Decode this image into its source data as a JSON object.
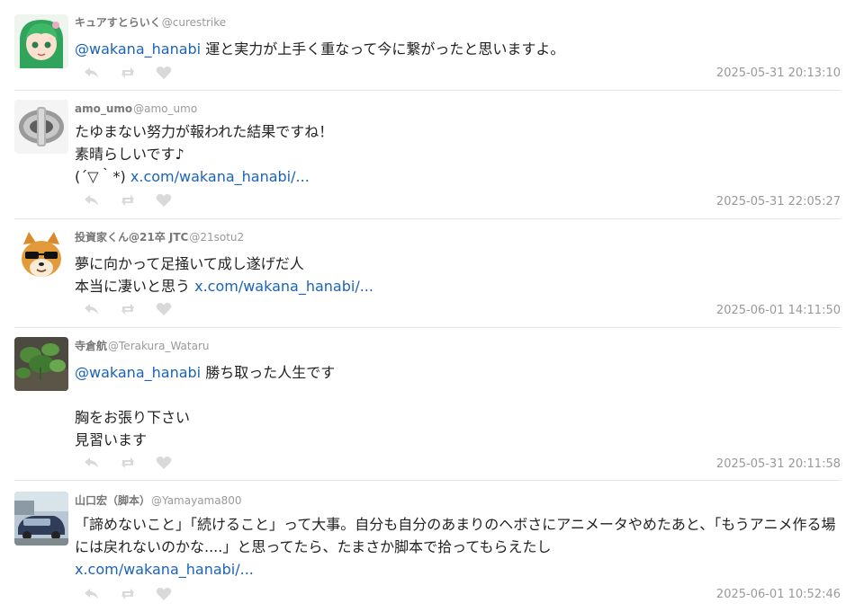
{
  "tweets": [
    {
      "name": "キュアすとらいく",
      "handle": "@curestrike",
      "lines": [
        {
          "mention": "@wakana_hanabi",
          "text": " 運と実力が上手く重なって今に繋がったと思いますよ。"
        }
      ],
      "timestamp": "2025-05-31 20:13:10"
    },
    {
      "name": "amo_umo",
      "handle": "@amo_umo",
      "lines": [
        {
          "text": "たゆまない努力が報われた結果ですね！"
        },
        {
          "text": "素晴らしいです♪"
        },
        {
          "text": "(´▽｀*) ",
          "link": "x.com/wakana_hanabi/..."
        }
      ],
      "timestamp": "2025-05-31 22:05:27"
    },
    {
      "name": "投資家くん@21卒 JTC",
      "handle": "@21sotu2",
      "lines": [
        {
          "text": "夢に向かって足掻いて成し遂げだ人"
        },
        {
          "text": "本当に凄いと思う ",
          "link": "x.com/wakana_hanabi/..."
        }
      ],
      "timestamp": "2025-06-01 14:11:50"
    },
    {
      "name": "寺倉航",
      "handle": "@Terakura_Wataru",
      "lines": [
        {
          "mention": "@wakana_hanabi",
          "text": " 勝ち取った人生です"
        },
        {
          "text": ""
        },
        {
          "text": "胸をお張り下さい"
        },
        {
          "text": "見習います"
        }
      ],
      "timestamp": "2025-05-31 20:11:58"
    },
    {
      "name": "山口宏（脚本）",
      "handle": "@Yamayama800",
      "lines": [
        {
          "text": "「諦めないこと」「続けること」って大事。自分も自分のあまりのヘボさにアニメータやめたあと、「もうアニメ作る場には戻れないのかな....」と思ってたら、たまさか脚本で拾ってもらえたし"
        },
        {
          "link": "x.com/wakana_hanabi/..."
        }
      ],
      "timestamp": "2025-06-01 10:52:46"
    }
  ],
  "icons": {
    "reply": "reply-icon",
    "retweet": "retweet-icon",
    "like": "heart-icon"
  },
  "colors": {
    "link": "#1b63b8",
    "meta": "#999999",
    "action_icon": "#d9d9d9"
  }
}
